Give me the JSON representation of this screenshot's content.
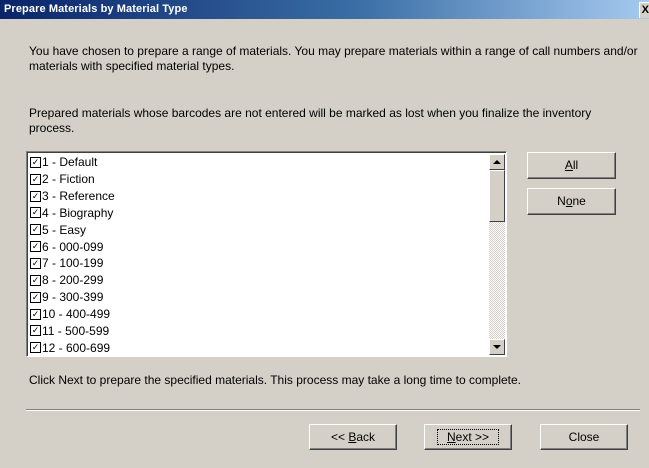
{
  "window": {
    "title": "Prepare Materials by Material Type",
    "close_glyph": "X"
  },
  "intro_text": "You have chosen to prepare a range of materials.  You may prepare materials within a range of call numbers and/or materials with specified material types.",
  "warning_text": "Prepared materials whose barcodes are not entered will be marked as lost when you finalize the inventory process.",
  "material_types": [
    {
      "label": "1 - Default",
      "checked": true
    },
    {
      "label": "2 - Fiction",
      "checked": true
    },
    {
      "label": "3 - Reference",
      "checked": true
    },
    {
      "label": "4 - Biography",
      "checked": true
    },
    {
      "label": "5 - Easy",
      "checked": true
    },
    {
      "label": "6 - 000-099",
      "checked": true
    },
    {
      "label": "7 - 100-199",
      "checked": true
    },
    {
      "label": "8 - 200-299",
      "checked": true
    },
    {
      "label": "9 - 300-399",
      "checked": true
    },
    {
      "label": "10 - 400-499",
      "checked": true
    },
    {
      "label": "11 - 500-599",
      "checked": true
    },
    {
      "label": "12 - 600-699",
      "checked": true
    }
  ],
  "buttons": {
    "all": {
      "prefix": "",
      "mnemonic": "A",
      "suffix": "ll"
    },
    "none": {
      "prefix": "N",
      "mnemonic": "o",
      "suffix": "ne"
    },
    "back": {
      "prefix": "<< ",
      "mnemonic": "B",
      "suffix": "ack"
    },
    "next": {
      "prefix": "",
      "mnemonic": "N",
      "suffix": "ext >>"
    },
    "close": {
      "label": "Close"
    }
  },
  "footer_text": "Click Next to prepare the specified materials. This process may take a long time to complete.",
  "colors": {
    "dialog_bg": "#d4d0c8",
    "titlebar_start": "#0a246a",
    "titlebar_end": "#a6caf0"
  }
}
